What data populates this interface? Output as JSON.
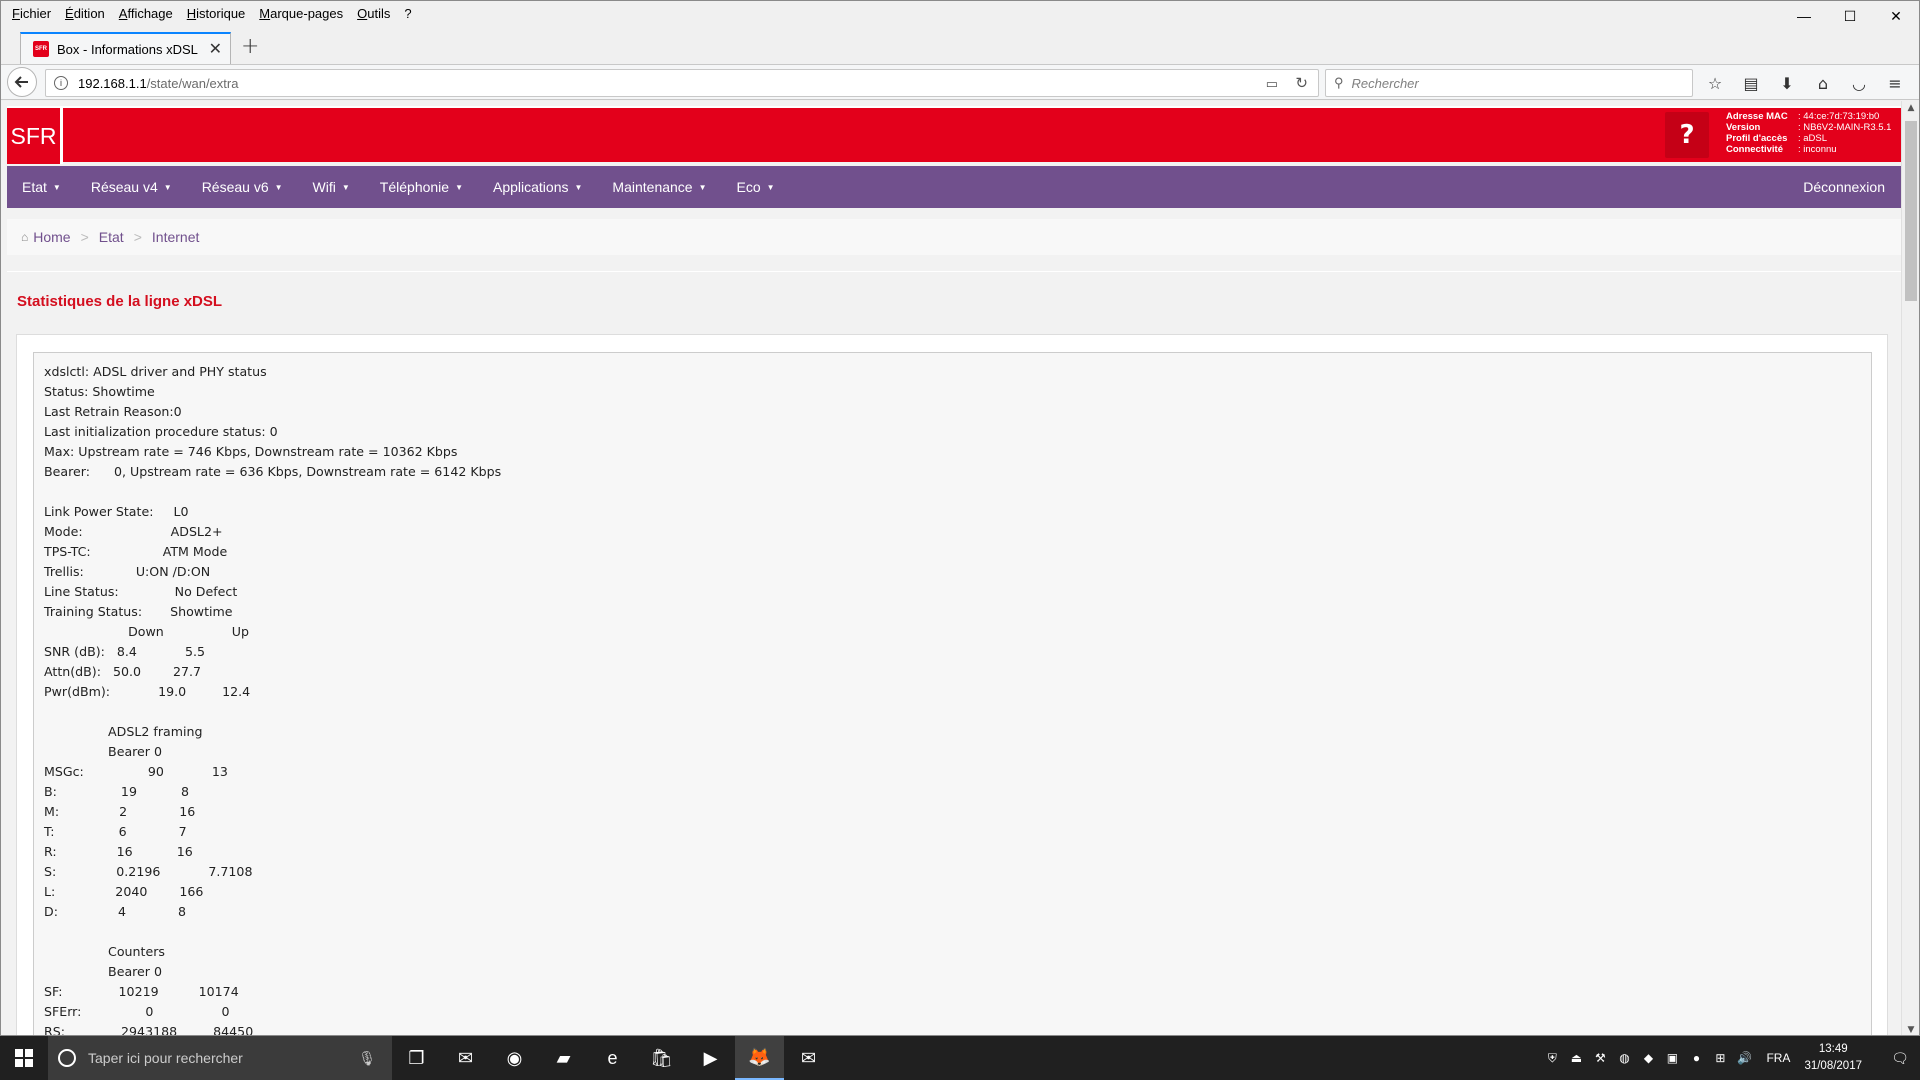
{
  "browser": {
    "menu": [
      "Fichier",
      "Édition",
      "Affichage",
      "Historique",
      "Marque-pages",
      "Outils",
      "?"
    ],
    "window_controls": [
      "—",
      "☐",
      "✕"
    ],
    "tab": {
      "favicon": "SFR",
      "title": "Box - Informations xDSL",
      "close": "✕"
    },
    "new_tab": "+",
    "url": {
      "host": "192.168.1.1",
      "path": "/state/wan/extra"
    },
    "search_placeholder": "Rechercher",
    "icons": [
      "back-arrow-icon",
      "info-icon",
      "reader-view-icon",
      "reload-icon",
      "search-icon",
      "bookmark-star-icon",
      "library-icon",
      "download-icon",
      "home-icon",
      "pocket-icon",
      "hamburger-menu-icon"
    ]
  },
  "sfr": {
    "logo": "SFR",
    "help": "?",
    "info": [
      {
        "key": "Adresse MAC",
        "value": ": 44:ce:7d:73:19:b0"
      },
      {
        "key": "Version",
        "value": ": NB6V2-MAIN-R3.5.1"
      },
      {
        "key": "Profil d'accès",
        "value": ": aDSL"
      },
      {
        "key": "Connectivité",
        "value": ": inconnu"
      }
    ],
    "accent_red": "#e3001b",
    "nav_purple": "#71508d"
  },
  "nav": {
    "items": [
      "Etat",
      "Réseau v4",
      "Réseau v6",
      "Wifi",
      "Téléphonie",
      "Applications",
      "Maintenance",
      "Eco"
    ],
    "logout": "Déconnexion"
  },
  "breadcrumb": {
    "home": "Home",
    "level1": "Etat",
    "level2": "Internet",
    "sep": ">"
  },
  "page": {
    "title": "Statistiques de la ligne xDSL",
    "stats": "xdslctl: ADSL driver and PHY status\nStatus: Showtime\nLast Retrain Reason:0\nLast initialization procedure status: 0\nMax: Upstream rate = 746 Kbps, Downstream rate = 10362 Kbps\nBearer:      0, Upstream rate = 636 Kbps, Downstream rate = 6142 Kbps\n\nLink Power State:     L0\nMode:                      ADSL2+\nTPS-TC:                  ATM Mode\nTrellis:             U:ON /D:ON\nLine Status:              No Defect\nTraining Status:       Showtime\n                     Down                 Up\nSNR (dB):   8.4            5.5\nAttn(dB):   50.0        27.7\nPwr(dBm):            19.0         12.4\n\n                ADSL2 framing\n                Bearer 0\nMSGc:                90            13\nB:                19           8\nM:               2             16\nT:                6             7\nR:               16           16\nS:               0.2196            7.7108\nL:               2040        166\nD:               4             8\n\n                Counters\n                Bearer 0\nSF:              10219          10174\nSFErr:                0                 0\nRS:              2943188         84450"
  },
  "taskbar": {
    "search_placeholder": "Taper ici pour rechercher",
    "apps": [
      "task-view-icon",
      "mail-icon",
      "chrome-icon",
      "file-explorer-icon",
      "edge-icon",
      "store-icon",
      "media-player-icon",
      "firefox-icon",
      "app-icon"
    ],
    "language": "FRA",
    "time": "13:49",
    "date": "31/08/2017"
  }
}
